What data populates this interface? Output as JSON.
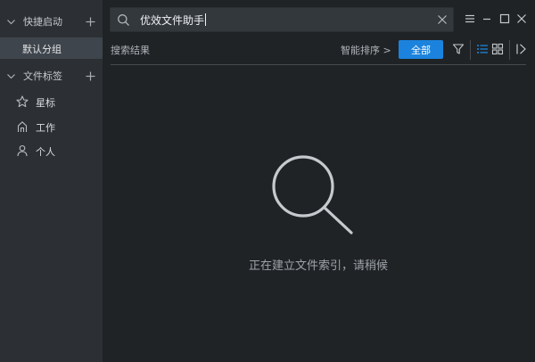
{
  "sidebar": {
    "quick_start": {
      "title": "快捷启动",
      "items": [
        {
          "label": "默认分组"
        }
      ]
    },
    "file_tags": {
      "title": "文件标签",
      "items": [
        {
          "label": "星标",
          "icon": "star-icon"
        },
        {
          "label": "工作",
          "icon": "home-icon"
        },
        {
          "label": "个人",
          "icon": "person-icon"
        }
      ]
    }
  },
  "search": {
    "value": "优效文件助手"
  },
  "toolbar": {
    "results_label": "搜索结果",
    "sort_label": "智能排序 >",
    "all_button": "全部"
  },
  "empty_state": {
    "message": "正在建立文件索引，请稍候"
  },
  "colors": {
    "accent": "#1b83dd",
    "sidebar_bg": "#2c3035",
    "main_bg": "#202326",
    "selected_item_bg": "#3f454c"
  }
}
